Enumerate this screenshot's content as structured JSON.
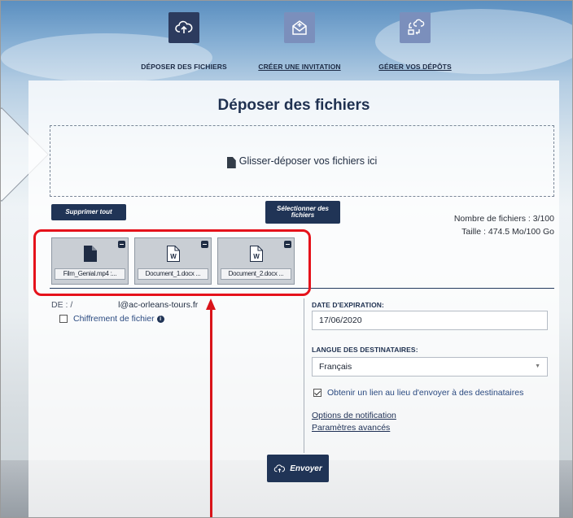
{
  "nav": {
    "deposer": "DÉPOSER DES FICHIERS",
    "invitation": "CRÉER UNE INVITATION",
    "gerer": "GÉRER VOS DÉPÔTS"
  },
  "upload": {
    "title": "Déposer des fichiers",
    "dropzone_text": "Glisser-déposer vos fichiers ici",
    "clear_label": "Supprimer tout",
    "select_label_1": "Sélectionner des",
    "select_label_2": "fichiers",
    "file_count": "Nombre de fichiers : 3/100",
    "size": "Taille : 474.5 Mo/100 Go",
    "files": [
      {
        "name": "Film_Genial.mp4 :...",
        "icon": "video-file-icon"
      },
      {
        "name": "Document_1.docx ...",
        "icon": "word-document-icon"
      },
      {
        "name": "Document_2.docx ...",
        "icon": "word-document-icon"
      }
    ]
  },
  "form": {
    "from_label": "DE : /",
    "from_email": "l@ac-orleans-tours.fr",
    "encrypt_label": "Chiffrement de fichier",
    "encrypt_checked": false,
    "expiry_label": "DATE D'EXPIRATION:",
    "expiry_value": "17/06/2020",
    "lang_label": "LANGUE DES DESTINATAIRES:",
    "lang_value": "Français",
    "get_link_label": "Obtenir un lien au lieu d'envoyer à des destinataires",
    "get_link_checked": true,
    "notif_link": "Options de notification",
    "advanced_link": "Paramètres avancés",
    "send_label": "Envoyer"
  },
  "colors": {
    "accent": "#203456",
    "nav_tile": "#7b8fbc",
    "highlight": "#e5121b"
  }
}
